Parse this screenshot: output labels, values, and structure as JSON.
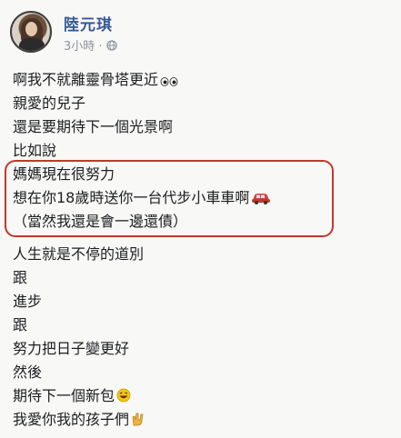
{
  "post": {
    "author": "陸元琪",
    "timestamp": "3小時 ·",
    "privacy_icon": "globe-icon",
    "lines": [
      "啊我不就離靈骨塔更近",
      "親愛的兒子",
      "還是要期待下一個光景啊",
      "比如說",
      "媽媽現在很努力",
      "想在你18歲時送你一台代步小車車啊",
      "（當然我還是會一邊還債）",
      "人生就是不停的道別",
      "跟",
      "進步",
      "跟",
      "努力把日子變更好",
      "然後",
      "期待下一個新包",
      "我愛你我的孩子們"
    ],
    "emoji": {
      "line0": "eyes-emoji",
      "line5": "car-emoji",
      "line13": "grinning-emoji",
      "line14": "love-you-hand-emoji"
    },
    "highlight_color": "#c0392b",
    "name_color": "#385898"
  }
}
